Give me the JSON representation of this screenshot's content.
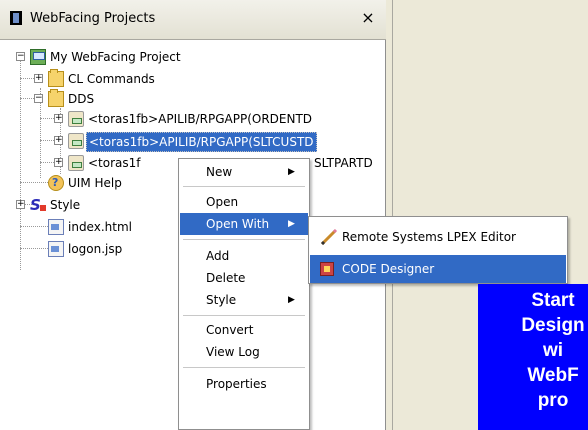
{
  "view": {
    "title": "WebFacing Projects",
    "close_glyph": "×"
  },
  "tree": {
    "root": "My WebFacing Project",
    "cl_commands": "CL Commands",
    "dds": "DDS",
    "dds_items": [
      "<toras1fb>APILIB/RPGAPP(ORDENTD",
      "<toras1fb>APILIB/RPGAPP(SLTCUSTD",
      "<toras1f",
      "SLTPARTD"
    ],
    "uim_help": "UIM Help",
    "style": "Style",
    "index": "index.html",
    "logon": "logon.jsp"
  },
  "context_menu": {
    "items": [
      "New",
      "Open",
      "Open With",
      "Add",
      "Delete",
      "Style",
      "Convert",
      "View Log",
      "Properties"
    ],
    "submenu_arrow": "▶"
  },
  "open_with_submenu": {
    "items": [
      "Remote Systems LPEX Editor",
      "CODE Designer"
    ]
  },
  "callout": {
    "text": "Start\nDesign\nwi\nWebF\npro"
  },
  "colors": {
    "selection": "#316ac5",
    "callout_bg": "#0000ff"
  }
}
